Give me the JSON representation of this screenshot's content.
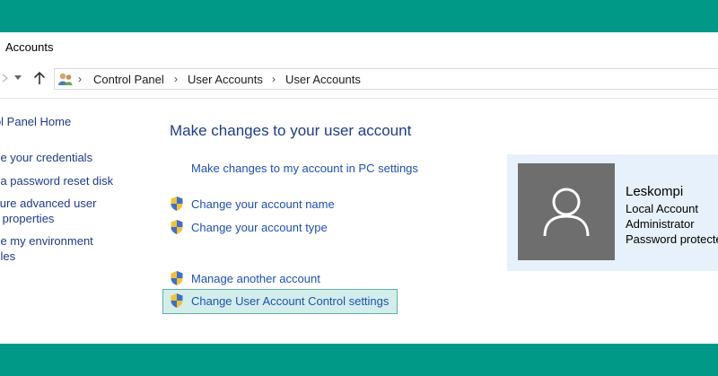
{
  "window": {
    "title": "Accounts"
  },
  "breadcrumb": [
    "Control Panel",
    "User Accounts",
    "User Accounts"
  ],
  "sidebar": {
    "items": [
      {
        "label": "trol Panel Home"
      },
      {
        "label": "age your credentials"
      },
      {
        "label": "te a password reset disk"
      },
      {
        "label": "figure advanced user",
        "label2": "ile properties"
      },
      {
        "label": "nge my environment",
        "label2": "ables"
      }
    ]
  },
  "main": {
    "heading": "Make changes to your user account",
    "pc_settings_link": "Make changes to my account in PC settings",
    "tasks": [
      {
        "label": "Change your account name",
        "icon": "uac-shield-icon"
      },
      {
        "label": "Change your account type",
        "icon": "uac-shield-icon"
      },
      {
        "label": "Manage another account",
        "icon": "uac-shield-icon"
      },
      {
        "label": "Change User Account Control settings",
        "icon": "uac-shield-icon"
      }
    ]
  },
  "user": {
    "name": "Leskompi",
    "account_type": "Local Account",
    "role": "Administrator",
    "password_status": "Password protected"
  },
  "colors": {
    "band": "#009887",
    "link": "#1f4fb3",
    "heading": "#1e3c8c",
    "user_panel": "#e6f1fb",
    "selected_bg": "#d3eeea"
  }
}
